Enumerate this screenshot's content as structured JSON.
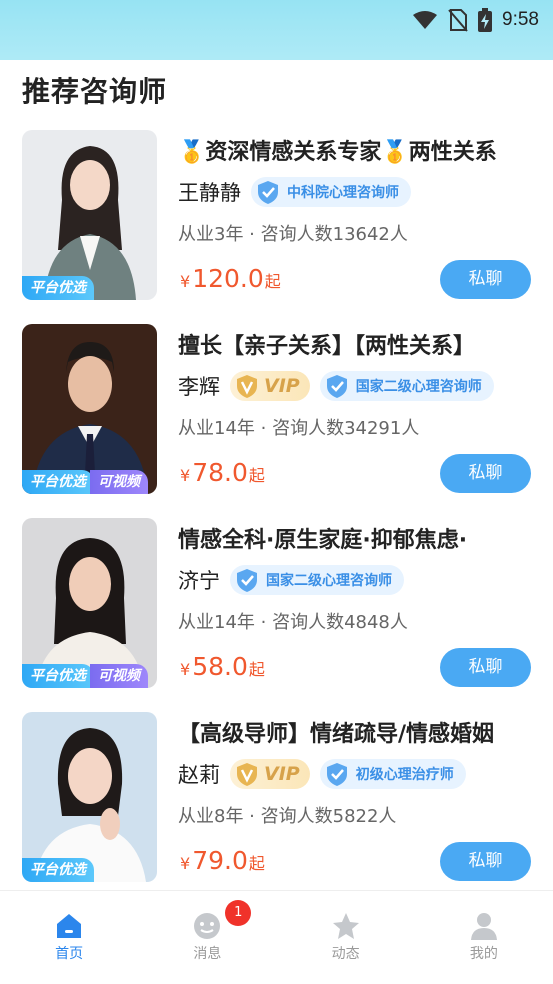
{
  "status_bar": {
    "time": "9:58",
    "icons": [
      "wifi-icon",
      "no-sim-icon",
      "battery-charging-icon"
    ]
  },
  "section": {
    "title": "推荐咨询师"
  },
  "counselors": [
    {
      "headline": "🥇资深情感关系专家🥇两性关系",
      "name": "王静静",
      "vip": null,
      "certification": "中科院心理咨询师",
      "stats": "从业3年 · 咨询人数13642人",
      "price_symbol": "¥",
      "price": "120.0",
      "price_suffix": "起",
      "badges": [
        "平台优选"
      ],
      "chat_label": "私聊"
    },
    {
      "headline": "擅长【亲子关系】【两性关系】",
      "name": "李辉",
      "vip": "VIP",
      "certification": "国家二级心理咨询师",
      "stats": "从业14年 · 咨询人数34291人",
      "price_symbol": "¥",
      "price": "78.0",
      "price_suffix": "起",
      "badges": [
        "平台优选",
        "可视频"
      ],
      "chat_label": "私聊"
    },
    {
      "headline": "情感全科·原生家庭·抑郁焦虑·",
      "name": "济宁",
      "vip": null,
      "certification": "国家二级心理咨询师",
      "stats": "从业14年 · 咨询人数4848人",
      "price_symbol": "¥",
      "price": "58.0",
      "price_suffix": "起",
      "badges": [
        "平台优选",
        "可视频"
      ],
      "chat_label": "私聊"
    },
    {
      "headline": "【高级导师】情绪疏导/情感婚姻",
      "name": "赵莉",
      "vip": "VIP",
      "certification": "初级心理治疗师",
      "stats": "从业8年 · 咨询人数5822人",
      "price_symbol": "¥",
      "price": "79.0",
      "price_suffix": "起",
      "badges": [
        "平台优选"
      ],
      "chat_label": "私聊"
    }
  ],
  "tabbar": {
    "tabs": [
      {
        "label": "首页",
        "icon": "home-icon",
        "active": true
      },
      {
        "label": "消息",
        "icon": "message-icon",
        "active": false,
        "badge": "1"
      },
      {
        "label": "动态",
        "icon": "star-icon",
        "active": false
      },
      {
        "label": "我的",
        "icon": "profile-icon",
        "active": false
      }
    ]
  },
  "colors": {
    "accent": "#4aa9f3",
    "price": "#f0582e",
    "active_tab": "#2b86ec",
    "status_bar": "#a5e8f5"
  }
}
